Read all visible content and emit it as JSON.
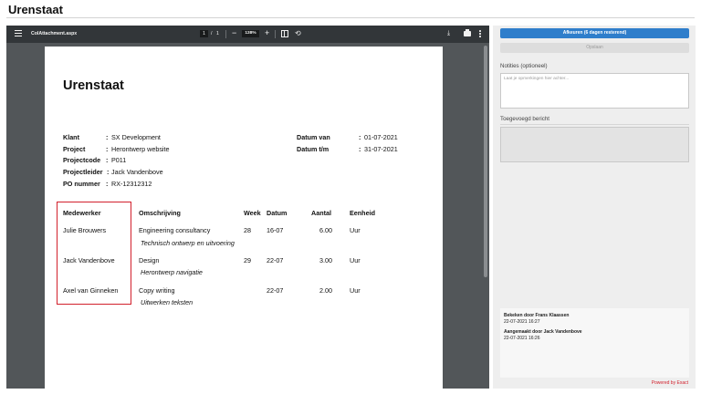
{
  "page": {
    "title": "Urenstaat"
  },
  "viewer": {
    "filename": "CoIAttachment.aspx",
    "current_page": "1",
    "page_separator": "/",
    "total_pages": "1",
    "zoom": "138%",
    "minus": "−",
    "plus": "+",
    "rotate_glyph": "⟲",
    "download_glyph": "⤓",
    "icons": [
      "menu-icon",
      "minus-icon",
      "plus-icon",
      "fit-page-icon",
      "rotate-icon",
      "download-icon",
      "print-icon",
      "more-icon"
    ]
  },
  "document": {
    "title": "Urenstaat",
    "fields_left": [
      {
        "label": "Klant",
        "value": "SX Development"
      },
      {
        "label": "Project",
        "value": "Herontwerp website"
      },
      {
        "label": "Projectcode",
        "value": "P011"
      },
      {
        "label": "Projectleider",
        "value": "Jack Vandenbove"
      },
      {
        "label": "PO nummer",
        "value": "RX-12312312"
      }
    ],
    "fields_right": [
      {
        "label": "Datum van",
        "value": "01-07-2021"
      },
      {
        "label": "Datum t/m",
        "value": "31-07-2021"
      }
    ],
    "colon": ":",
    "table": {
      "headers": {
        "employee": "Medewerker",
        "description": "Omschrijving",
        "week": "Week",
        "date": "Datum",
        "amount": "Aantal",
        "unit": "Eenheid"
      },
      "rows": [
        {
          "employee": "Julie Brouwers",
          "description": "Engineering consultancy",
          "note": "Technisch ontwerp en uitvoering",
          "week": "28",
          "date": "16-07",
          "amount": "6.00",
          "unit": "Uur"
        },
        {
          "employee": "Jack Vandenbove",
          "description": "Design",
          "note": "Herontwerp navigatie",
          "week": "29",
          "date": "22-07",
          "amount": "3.00",
          "unit": "Uur"
        },
        {
          "employee": "Axel van Ginneken",
          "description": "Copy writing",
          "note": "Uitwerken teksten",
          "week": "",
          "date": "22-07",
          "amount": "2.00",
          "unit": "Uur"
        }
      ]
    },
    "highlight_color": "#d2202c"
  },
  "sidebar": {
    "approve_label": "Afkeuren (6 dagen resterend)",
    "save_label": "Opslaan",
    "notes_label": "Notities (optioneel)",
    "notes_placeholder": "Laat je opmerkingen hier achter...",
    "message_label": "Toegevoegd bericht",
    "history": [
      {
        "title": "Bekeken door Frans Klaassen",
        "time": "22-07-2021 16:27"
      },
      {
        "title": "Aangemaakt door Jack Vandenbove",
        "time": "22-07-2021 16:26"
      }
    ],
    "powered_by": "Powered by Exact",
    "accent_color": "#2f7ecb"
  }
}
